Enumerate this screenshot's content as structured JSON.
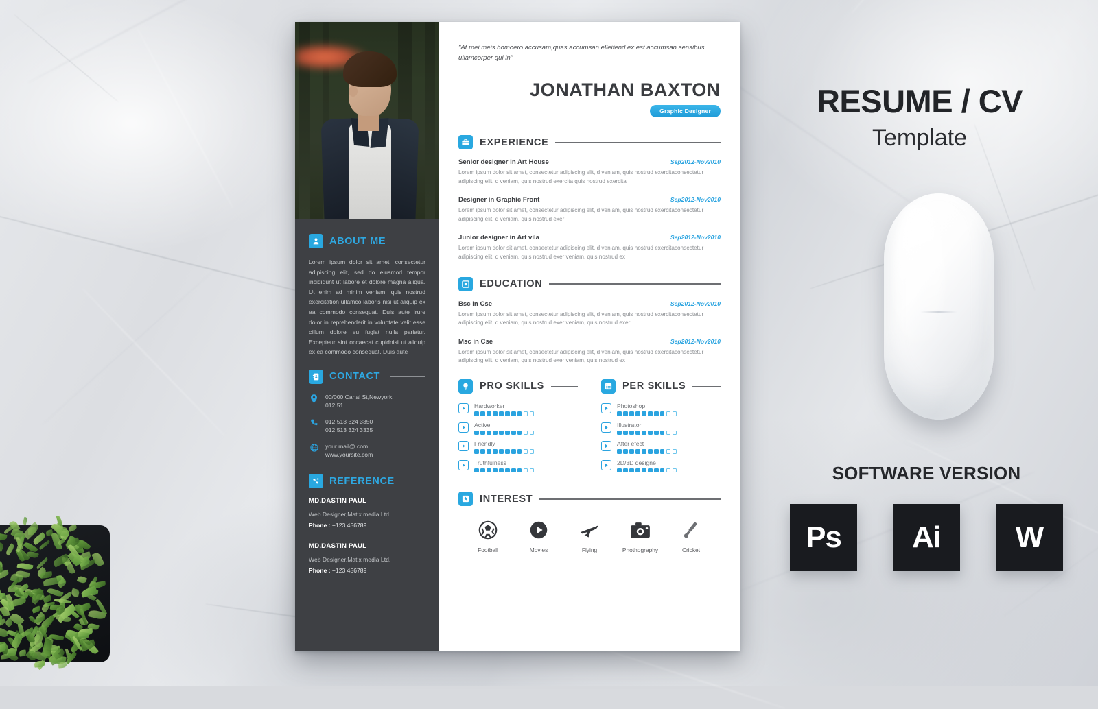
{
  "resume": {
    "quote": "\"At mei meis homoero accusam,quas accumsan elleifend ex est accumsan sensibus ullamcorper qui in\"",
    "name": "JONATHAN BAXTON",
    "role_badge": "Graphic Designer",
    "accent_color": "#2ba4e0",
    "dark_panel_color": "#3e4044",
    "about": {
      "title": "ABOUT ME",
      "icon": "user-icon",
      "text": "Lorem ipsum dolor sit amet, consectetur adipiscing elit, sed do eiusmod tempor incididunt ut labore et dolore magna aliqua. Ut enim ad minim veniam, quis nostrud exercitation ullamco laboris nisi ut aliquip ex ea commodo consequat. Duis aute irure dolor in reprehenderit in voluptate velit esse cillum dolore eu fugiat nulla pariatur. Excepteur sint occaecat cupidnisi ut aliquip ex ea commodo consequat. Duis aute"
    },
    "experience": {
      "title": "EXPERIENCE",
      "icon": "briefcase-icon",
      "items": [
        {
          "title": "Senior designer in Art House",
          "date": "Sep2012-Nov2010",
          "desc": "Lorem ipsum dolor sit amet, consectetur adipiscing elit, d veniam, quis nostrud exercitaconsectetur adipiscing elit, d veniam, quis nostrud exercita quis nostrud exercita"
        },
        {
          "title": "Designer in Graphic Front",
          "date": "Sep2012-Nov2010",
          "desc": "Lorem ipsum dolor sit amet, consectetur adipiscing elit, d veniam, quis nostrud exercitaconsectetur adipiscing elit, d veniam, quis nostrud exer"
        },
        {
          "title": "Junior designer in Art vila",
          "date": "Sep2012-Nov2010",
          "desc": "Lorem ipsum dolor sit amet, consectetur adipiscing elit, d veniam, quis nostrud exercitaconsectetur adipiscing elit, d veniam, quis nostrud exer  veniam, quis nostrud ex"
        }
      ]
    },
    "education": {
      "title": "EDUCATION",
      "icon": "graduation-icon",
      "items": [
        {
          "title": "Bsc in Cse",
          "date": "Sep2012-Nov2010",
          "desc": "Lorem ipsum dolor sit amet, consectetur adipiscing elit, d veniam, quis nostrud exercitaconsectetur adipiscing elit, d veniam, quis nostrud exer  veniam, quis nostrud exer"
        },
        {
          "title": "Msc in Cse",
          "date": "Sep2012-Nov2010",
          "desc": "Lorem ipsum dolor sit amet, consectetur adipiscing elit, d veniam, quis nostrud exercitaconsectetur adipiscing elit, d veniam, quis nostrud exer  veniam, quis nostrud ex"
        }
      ]
    },
    "contact": {
      "title": "CONTACT",
      "icon": "phone-book-icon",
      "rows": [
        {
          "icon": "location-pin-icon",
          "lines": [
            "00/000 Canal St,Newyork",
            "012 51"
          ]
        },
        {
          "icon": "phone-icon",
          "lines": [
            "012 513 324 3350",
            "012 513 324 3335"
          ]
        },
        {
          "icon": "globe-icon",
          "lines": [
            "your mail@.com",
            "www.yoursite.com"
          ]
        }
      ]
    },
    "reference": {
      "title": "REFERENCE",
      "icon": "network-icon",
      "items": [
        {
          "name": "MD.DASTIN PAUL",
          "role": "Web Designer,Matix media Ltd.",
          "phone_label": "Phone :",
          "phone": "+123  456789"
        },
        {
          "name": "MD.DASTIN PAUL",
          "role": "Web Designer,Matix media Ltd.",
          "phone_label": "Phone :",
          "phone": "+123  456789"
        }
      ]
    },
    "pro_skills": {
      "title": "PRO SKILLS",
      "icon": "bulb-icon",
      "items": [
        {
          "name": "Hardworker",
          "filled": 8,
          "total": 10
        },
        {
          "name": "Active",
          "filled": 8,
          "total": 10
        },
        {
          "name": "Friendly",
          "filled": 8,
          "total": 10
        },
        {
          "name": "Truthfulness",
          "filled": 8,
          "total": 10
        }
      ]
    },
    "per_skills": {
      "title": "PER SKILLS",
      "icon": "list-icon",
      "items": [
        {
          "name": "Photoshop",
          "filled": 8,
          "total": 10
        },
        {
          "name": "Illustrator",
          "filled": 8,
          "total": 10
        },
        {
          "name": "After efect",
          "filled": 8,
          "total": 10
        },
        {
          "name": "2D/3D designe",
          "filled": 8,
          "total": 10
        }
      ]
    },
    "interest": {
      "title": "INTEREST",
      "icon": "star-grid-icon",
      "items": [
        {
          "label": "Football",
          "icon": "football-icon"
        },
        {
          "label": "Movies",
          "icon": "play-circle-icon"
        },
        {
          "label": "Flying",
          "icon": "airplane-icon"
        },
        {
          "label": "Phothography",
          "icon": "camera-icon"
        },
        {
          "label": "Cricket",
          "icon": "cricket-icon"
        }
      ]
    }
  },
  "promo": {
    "title": "RESUME / CV",
    "subtitle": "Template",
    "software_title": "SOFTWARE VERSION",
    "software": [
      {
        "label": "Ps",
        "name": "photoshop-badge"
      },
      {
        "label": "Ai",
        "name": "illustrator-badge"
      },
      {
        "label": "W",
        "name": "word-badge"
      }
    ]
  }
}
